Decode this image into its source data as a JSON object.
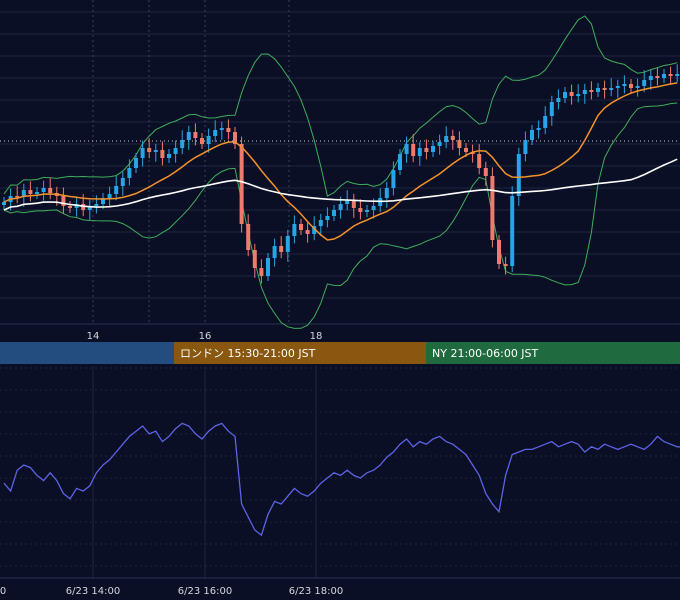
{
  "colors": {
    "background": "#0b0f25",
    "grid": "#1e2440",
    "candle_up": "#26a6e6",
    "candle_down": "#ef7b6e",
    "bollinger": "#3fae5a",
    "ma_short": "#f5922a",
    "ma_long": "#ffffff",
    "oscillator": "#5c63e6",
    "session_tokyo": "#234d7e",
    "session_london": "#8a5710",
    "session_ny": "#1f6a3e",
    "axis_text": "#d6d6dc"
  },
  "price_axis": {
    "labels": [
      "14",
      "16",
      "18"
    ]
  },
  "sessions": [
    {
      "label": "",
      "color": "#234d7e"
    },
    {
      "label": "ロンドン 15:30-21:00 JST",
      "color": "#8a5710"
    },
    {
      "label": "NY 21:00-06:00 JST",
      "color": "#1f6a3e"
    }
  ],
  "time_axis": {
    "labels": [
      "0",
      "6/23 14:00",
      "6/23 16:00",
      "6/23 18:00"
    ]
  },
  "chart_data": [
    {
      "type": "candlestick",
      "title": "",
      "x_ticks": [
        "14",
        "16",
        "18"
      ],
      "grid": true,
      "close": [
        -0.1,
        0.2,
        0.15,
        0.5,
        0.3,
        0.4,
        0.6,
        0.35,
        0.2,
        -0.3,
        -0.4,
        -0.2,
        -0.5,
        -0.3,
        -0.2,
        0.1,
        0.3,
        0.7,
        1.1,
        1.6,
        2.1,
        2.6,
        2.4,
        2.5,
        2.1,
        2.3,
        2.6,
        3.0,
        3.4,
        3.1,
        2.8,
        3.2,
        3.5,
        3.6,
        3.4,
        2.8,
        -1.2,
        -2.5,
        -3.4,
        -3.8,
        -2.9,
        -2.3,
        -2.6,
        -1.8,
        -1.2,
        -1.5,
        -1.7,
        -1.3,
        -1.0,
        -0.8,
        -0.5,
        -0.2,
        0.0,
        -0.4,
        -0.6,
        -0.5,
        -0.3,
        0.1,
        0.6,
        1.5,
        2.3,
        2.8,
        2.2,
        2.6,
        2.4,
        2.7,
        2.9,
        3.2,
        3.0,
        2.6,
        2.4,
        2.3,
        1.6,
        1.2,
        -2.0,
        -3.2,
        -3.3,
        0.2,
        2.3,
        3.0,
        3.5,
        3.6,
        4.2,
        4.9,
        5.1,
        5.4,
        5.2,
        5.3,
        5.5,
        5.4,
        5.6,
        5.5,
        5.6,
        5.7,
        5.8,
        5.6,
        5.7,
        6.0,
        6.2,
        6.1,
        6.3,
        6.2,
        6.3
      ]
    },
    {
      "type": "line",
      "title": "",
      "x_ticks": [
        "0",
        "6/23 14:00",
        "6/23 16:00",
        "6/23 18:00"
      ],
      "series": [
        {
          "values": [
            -0.2,
            -0.5,
            0.3,
            0.5,
            0.4,
            0.1,
            -0.1,
            0.2,
            -0.1,
            -0.6,
            -0.8,
            -0.4,
            -0.5,
            -0.3,
            0.2,
            0.5,
            0.7,
            1.0,
            1.3,
            1.6,
            1.8,
            2.0,
            1.7,
            1.8,
            1.4,
            1.6,
            1.9,
            2.1,
            2.0,
            1.7,
            1.5,
            1.8,
            2.0,
            2.1,
            1.8,
            1.6,
            -1.0,
            -1.5,
            -2.0,
            -2.2,
            -1.4,
            -0.9,
            -1.0,
            -0.7,
            -0.4,
            -0.6,
            -0.7,
            -0.5,
            -0.2,
            0.0,
            0.2,
            0.1,
            0.3,
            0.1,
            0.0,
            0.2,
            0.3,
            0.5,
            0.8,
            1.0,
            1.3,
            1.5,
            1.2,
            1.4,
            1.3,
            1.5,
            1.6,
            1.4,
            1.3,
            1.1,
            0.9,
            0.5,
            0.1,
            -0.6,
            -1.0,
            -1.3,
            0.1,
            0.9,
            1.0,
            1.1,
            1.1,
            1.2,
            1.3,
            1.4,
            1.2,
            1.3,
            1.4,
            1.3,
            1.0,
            1.2,
            1.1,
            1.3,
            1.2,
            1.1,
            1.2,
            1.3,
            1.2,
            1.1,
            1.3,
            1.6,
            1.4,
            1.3,
            1.2,
            1.2
          ]
        }
      ]
    }
  ]
}
